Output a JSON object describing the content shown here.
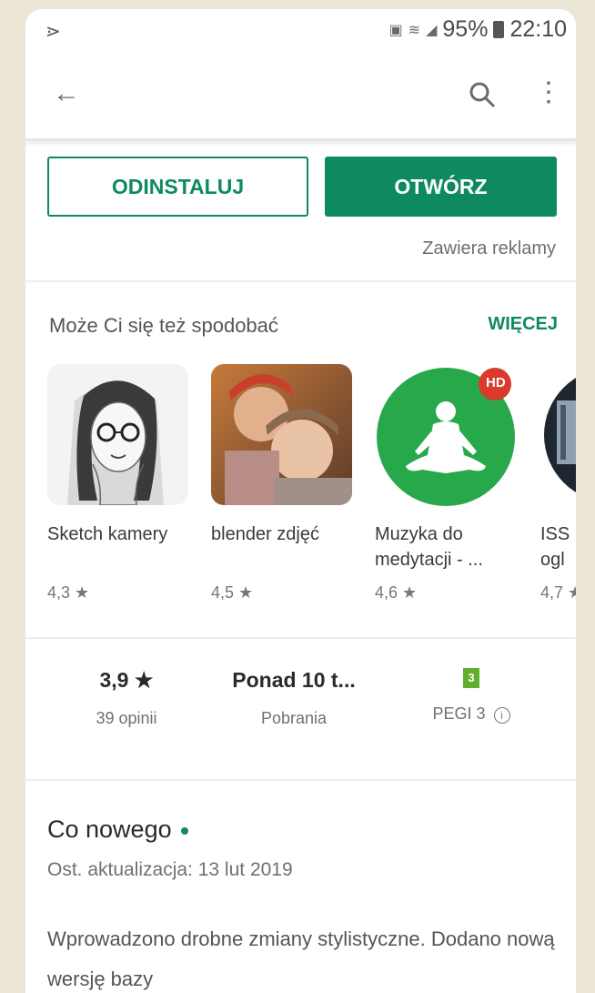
{
  "status": {
    "battery": "95%",
    "time": "22:10"
  },
  "actions": {
    "uninstall": "ODINSTALUJ",
    "open": "OTWÓRZ",
    "ads_note": "Zawiera reklamy"
  },
  "recommendations": {
    "title": "Może Ci się też spodobać",
    "more": "WIĘCEJ",
    "items": [
      {
        "name": "Sketch kamery",
        "rating": "4,3 ★"
      },
      {
        "name": "blender zdjęć",
        "rating": "4,5 ★"
      },
      {
        "name": "Muzyka do medytacji - ...",
        "rating": "4,6 ★",
        "badge": "HD"
      },
      {
        "name": "ISS ogl",
        "rating": "4,7 ★"
      }
    ]
  },
  "stats": {
    "rating": "3,9 ★",
    "reviews": "39 opinii",
    "downloads": "Ponad 10 t...",
    "downloads_label": "Pobrania",
    "pegi_badge": "3",
    "pegi_label": "PEGI 3"
  },
  "whats_new": {
    "title": "Co nowego",
    "date": "Ost. aktualizacja: 13 lut 2019",
    "body": "Wprowadzono drobne zmiany stylistyczne. Dodano nową wersję bazy"
  },
  "colors": {
    "accent": "#0f8a5f"
  }
}
